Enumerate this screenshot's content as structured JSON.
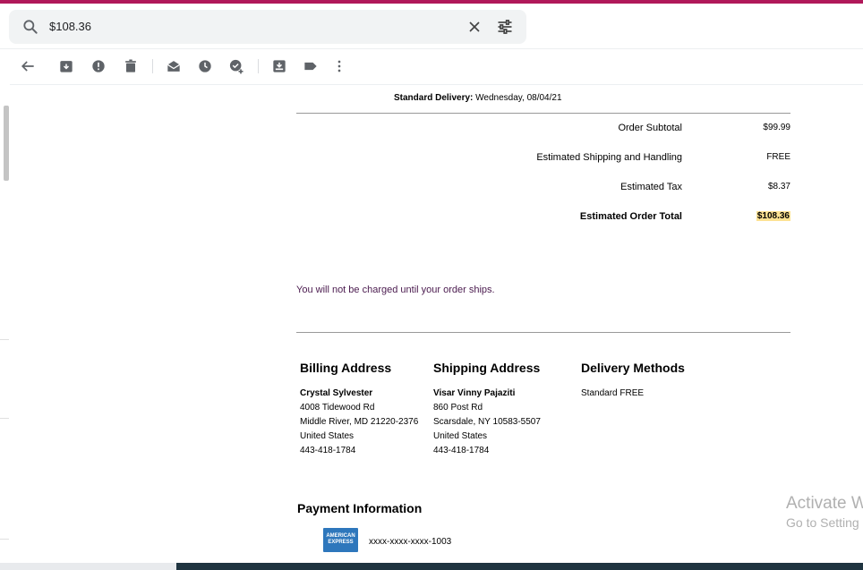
{
  "search": {
    "query": "$108.36",
    "icons": {
      "search": "search-icon",
      "clear": "close-icon",
      "options": "tune-icon"
    }
  },
  "toolbar": {
    "icons": [
      "back-arrow-icon",
      "archive-icon",
      "report-spam-icon",
      "delete-icon",
      "mark-as-read-icon",
      "snooze-icon",
      "add-to-tasks-icon",
      "move-to-icon",
      "label-icon",
      "more-vertical-icon"
    ]
  },
  "email": {
    "delivery_label": "Standard Delivery:",
    "delivery_date": "Wednesday, 08/04/21",
    "summary": [
      {
        "label": "Order Subtotal",
        "value": "$99.99"
      },
      {
        "label": "Estimated Shipping and Handling",
        "value": "FREE"
      },
      {
        "label": "Estimated Tax",
        "value": "$8.37"
      },
      {
        "label": "Estimated Order Total",
        "value": "$108.36"
      }
    ],
    "notice": "You will not be charged until your order ships.",
    "billing": {
      "heading": "Billing Address",
      "name": "Crystal Sylvester",
      "street": "4008 Tidewood Rd",
      "city": "Middle River, MD 21220-2376",
      "country": "United States",
      "phone": "443-418-1784"
    },
    "shipping": {
      "heading": "Shipping Address",
      "name": "Visar Vinny Pajaziti",
      "street": "860 Post Rd",
      "city": "Scarsdale, NY 10583-5507",
      "country": "United States",
      "phone": "443-418-1784"
    },
    "delivery_methods": {
      "heading": "Delivery Methods",
      "value": "Standard FREE"
    },
    "payment": {
      "heading": "Payment Information",
      "card_logo_text": "AMERICAN EXPRESS",
      "card_number": "xxxx-xxxx-xxxx-1003"
    }
  },
  "watermark": {
    "line1": "Activate W",
    "line2": "Go to Setting"
  },
  "colors": {
    "top_stripe": "#b0185a",
    "highlight": "#fde293",
    "notice_text": "#4a1a4e",
    "amex_blue": "#2e77bc"
  }
}
